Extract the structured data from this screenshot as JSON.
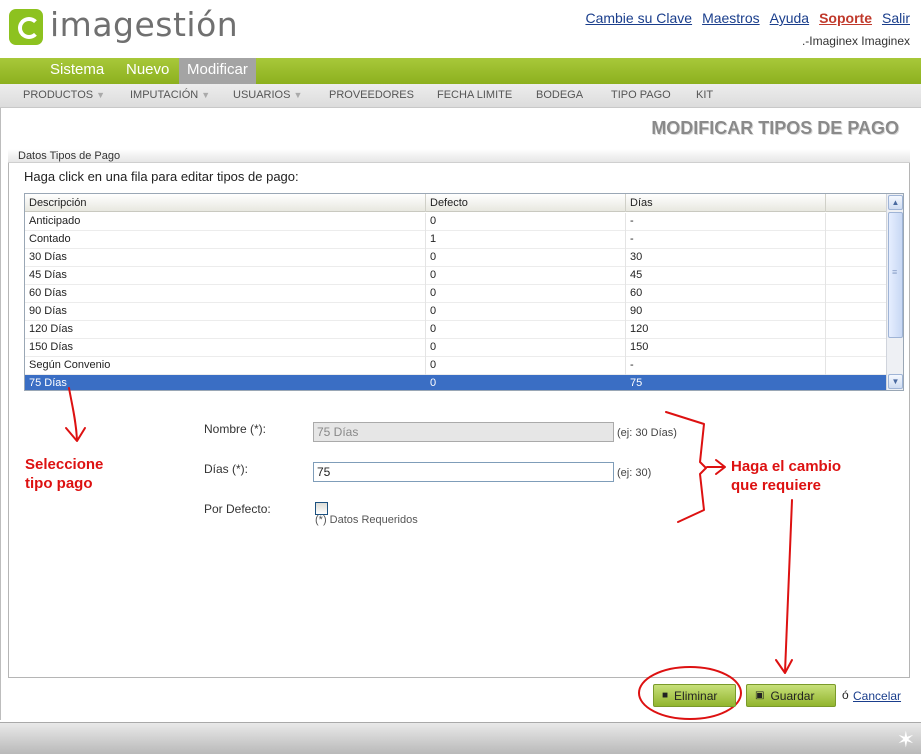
{
  "header": {
    "logo_text": "imagestión",
    "links": [
      "Cambie su Clave",
      "Maestros",
      "Ayuda",
      "Soporte",
      "Salir"
    ],
    "user": ".-Imaginex Imaginex"
  },
  "menu": {
    "items": [
      "Sistema",
      "Nuevo",
      "Modificar"
    ],
    "active": "Modificar"
  },
  "submenu": {
    "items": [
      "PRODUCTOS",
      "IMPUTACIÓN",
      "USUARIOS",
      "PROVEEDORES",
      "FECHA LIMITE",
      "BODEGA",
      "TIPO PAGO",
      "KIT"
    ],
    "dropdown_arrow": "▼"
  },
  "page": {
    "title": "MODIFICAR TIPOS DE PAGO",
    "legend": "Datos Tipos de Pago",
    "instruction": "Haga click en una fila para editar tipos de pago:"
  },
  "grid": {
    "columns": [
      "Descripción",
      "Defecto",
      "Días"
    ],
    "rows": [
      [
        "Anticipado",
        "0",
        "-"
      ],
      [
        "Contado",
        "1",
        "-"
      ],
      [
        "30 Días",
        "0",
        "30"
      ],
      [
        "45 Días",
        "0",
        "45"
      ],
      [
        "60 Días",
        "0",
        "60"
      ],
      [
        "90 Días",
        "0",
        "90"
      ],
      [
        "120 Días",
        "0",
        "120"
      ],
      [
        "150 Días",
        "0",
        "150"
      ],
      [
        "Según Convenio",
        "0",
        "-"
      ],
      [
        "75 Días",
        "0",
        "75"
      ]
    ],
    "selected_row": 9
  },
  "form": {
    "nombre_label": "Nombre (*):",
    "nombre_value": "75 Días",
    "nombre_hint": "(ej: 30 Días)",
    "dias_label": "Días (*):",
    "dias_value": "75",
    "dias_hint": "(ej: 30)",
    "defecto_label": "Por Defecto:",
    "required_note": "(*) Datos Requeridos"
  },
  "annotations": {
    "select_line1": "Seleccione",
    "select_line2": "tipo pago",
    "change_line1": "Haga el cambio",
    "change_line2": "que requiere"
  },
  "actions": {
    "delete_label": "Eliminar",
    "save_label": "Guardar",
    "or_text": "ó",
    "cancel_label": "Cancelar"
  },
  "colors": {
    "accent_green": "#8cb01e",
    "selection_blue": "#3a6ec4",
    "annotation_red": "#dd1111"
  }
}
